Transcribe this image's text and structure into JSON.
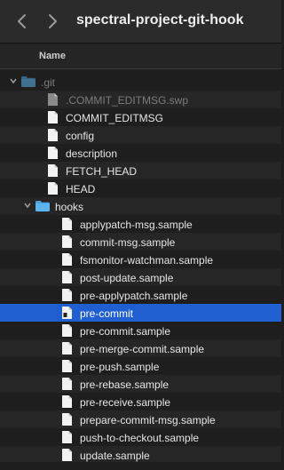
{
  "toolbar": {
    "back_icon": "chevron-left-icon",
    "forward_icon": "chevron-right-icon",
    "title": "spectral-project-git-hook"
  },
  "column_header": {
    "name": "Name"
  },
  "rows": [
    {
      "label": ".git",
      "type": "folder",
      "depth": 0,
      "expanded": true,
      "dim": true
    },
    {
      "label": ".COMMIT_EDITMSG.swp",
      "type": "file",
      "depth": 1,
      "dim": true
    },
    {
      "label": "COMMIT_EDITMSG",
      "type": "file",
      "depth": 1
    },
    {
      "label": "config",
      "type": "file",
      "depth": 1
    },
    {
      "label": "description",
      "type": "file",
      "depth": 1
    },
    {
      "label": "FETCH_HEAD",
      "type": "file",
      "depth": 1
    },
    {
      "label": "HEAD",
      "type": "file",
      "depth": 1
    },
    {
      "label": "hooks",
      "type": "folder",
      "depth": 1,
      "expanded": true
    },
    {
      "label": "applypatch-msg.sample",
      "type": "file",
      "depth": 2
    },
    {
      "label": "commit-msg.sample",
      "type": "file",
      "depth": 2
    },
    {
      "label": "fsmonitor-watchman.sample",
      "type": "file",
      "depth": 2
    },
    {
      "label": "post-update.sample",
      "type": "file",
      "depth": 2
    },
    {
      "label": "pre-applypatch.sample",
      "type": "file",
      "depth": 2
    },
    {
      "label": "pre-commit",
      "type": "exec",
      "depth": 2,
      "selected": true
    },
    {
      "label": "pre-commit.sample",
      "type": "file",
      "depth": 2
    },
    {
      "label": "pre-merge-commit.sample",
      "type": "file",
      "depth": 2
    },
    {
      "label": "pre-push.sample",
      "type": "file",
      "depth": 2
    },
    {
      "label": "pre-rebase.sample",
      "type": "file",
      "depth": 2
    },
    {
      "label": "pre-receive.sample",
      "type": "file",
      "depth": 2
    },
    {
      "label": "prepare-commit-msg.sample",
      "type": "file",
      "depth": 2
    },
    {
      "label": "push-to-checkout.sample",
      "type": "file",
      "depth": 2
    },
    {
      "label": "update.sample",
      "type": "file",
      "depth": 2
    }
  ],
  "colors": {
    "selection": "#1f5fd1",
    "folder": "#4aa3df"
  }
}
